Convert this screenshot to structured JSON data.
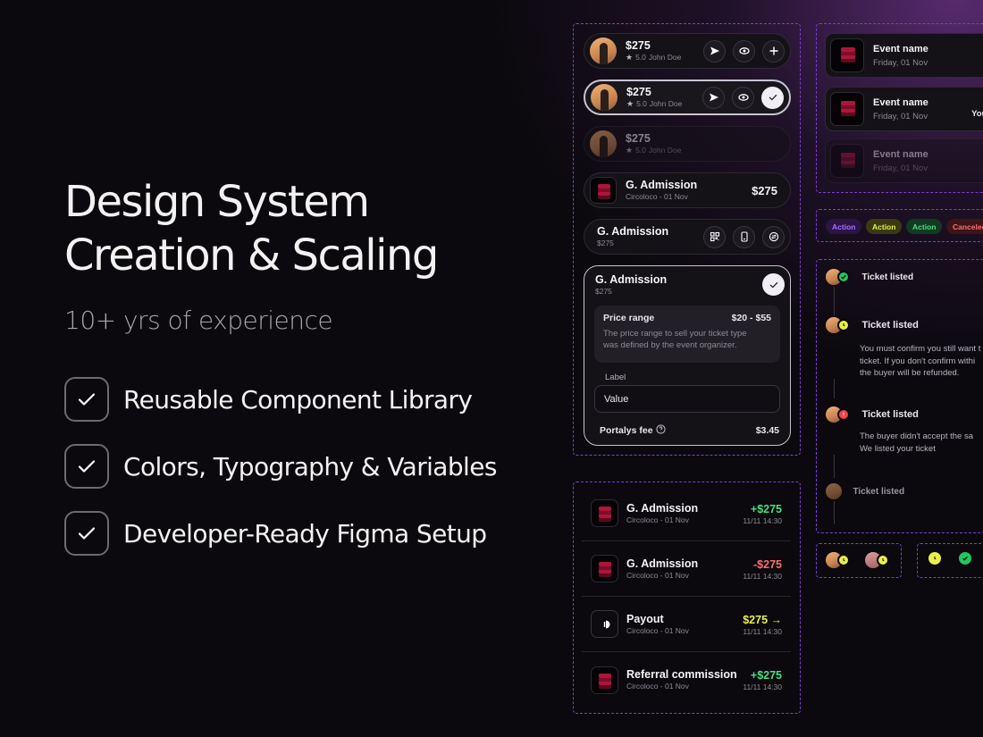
{
  "hero": {
    "title_line1": "Design System",
    "title_line2": "Creation & Scaling",
    "subtitle": "10+ yrs of experience",
    "features": [
      "Reusable Component Library",
      "Colors, Typography & Variables",
      "Developer-Ready Figma Setup"
    ]
  },
  "listing_cards": [
    {
      "price": "$275",
      "rating": "5.0",
      "seller": "John Doe"
    },
    {
      "price": "$275",
      "rating": "5.0",
      "seller": "John Doe"
    },
    {
      "price": "$275",
      "rating": "5.0",
      "seller": "John Doe"
    }
  ],
  "ticket_card": {
    "title": "G. Admission",
    "subtitle": "Circoloco - 01 Nov",
    "price": "$275"
  },
  "ticket_actions_card": {
    "title": "G. Admission",
    "price": "$275"
  },
  "expanded_card": {
    "title": "G. Admission",
    "price": "$275",
    "price_range_label": "Price range",
    "price_range_value": "$20 - $55",
    "price_range_desc_line1": "The price range to sell your ticket type",
    "price_range_desc_line2": "was defined by the event organizer.",
    "field_label": "Label",
    "field_value": "Value",
    "fee_label": "Portalys fee",
    "fee_value": "$3.45"
  },
  "transactions": [
    {
      "title": "G. Admission",
      "subtitle": "Circoloco - 01 Nov",
      "amount": "+$275",
      "date": "11/11 14:30",
      "color": "#4ade80"
    },
    {
      "title": "G. Admission",
      "subtitle": "Circoloco - 01 Nov",
      "amount": "-$275",
      "date": "11/11 14:30",
      "color": "#f87171"
    },
    {
      "title": "Payout",
      "subtitle": "Circoloco - 01 Nov",
      "amount": "$275 →",
      "date": "11/11 14:30",
      "color": "#e8f04a"
    },
    {
      "title": "Referral commission",
      "subtitle": "Circoloco - 01 Nov",
      "amount": "+$275",
      "date": "11/11 14:30",
      "color": "#4ade80"
    }
  ],
  "events": [
    {
      "name": "Event name",
      "date": "Friday, 01 Nov",
      "extra": ""
    },
    {
      "name": "Event name",
      "date": "Friday, 01 Nov",
      "extra": "Your"
    },
    {
      "name": "Event name",
      "date": "Friday, 01 Nov",
      "extra": ""
    }
  ],
  "badges": [
    {
      "label": "Action",
      "fg": "#b06cff",
      "bg": "#2a1545"
    },
    {
      "label": "Action",
      "fg": "#e8f04a",
      "bg": "#3a3a12"
    },
    {
      "label": "Action",
      "fg": "#4ade80",
      "bg": "#123a22"
    },
    {
      "label": "Canceled",
      "fg": "#f87171",
      "bg": "#3d1418"
    }
  ],
  "timeline": [
    {
      "title": "Ticket listed",
      "status": "green",
      "lines": []
    },
    {
      "title": "Ticket listed",
      "status": "yellow",
      "lines": [
        "You must confirm you still want t",
        "ticket. If you don't confirm withi",
        "the buyer will be refunded."
      ]
    },
    {
      "title": "Ticket listed",
      "status": "red",
      "lines": [
        "The buyer didn't accept the sa",
        "We listed your ticket"
      ]
    },
    {
      "title": "Ticket listed",
      "status": "none",
      "lines": []
    }
  ],
  "colors": {
    "accent_dashed": "#7a3fd6",
    "green": "#4ade80",
    "yellow": "#e8f04a",
    "red": "#ef4444"
  }
}
